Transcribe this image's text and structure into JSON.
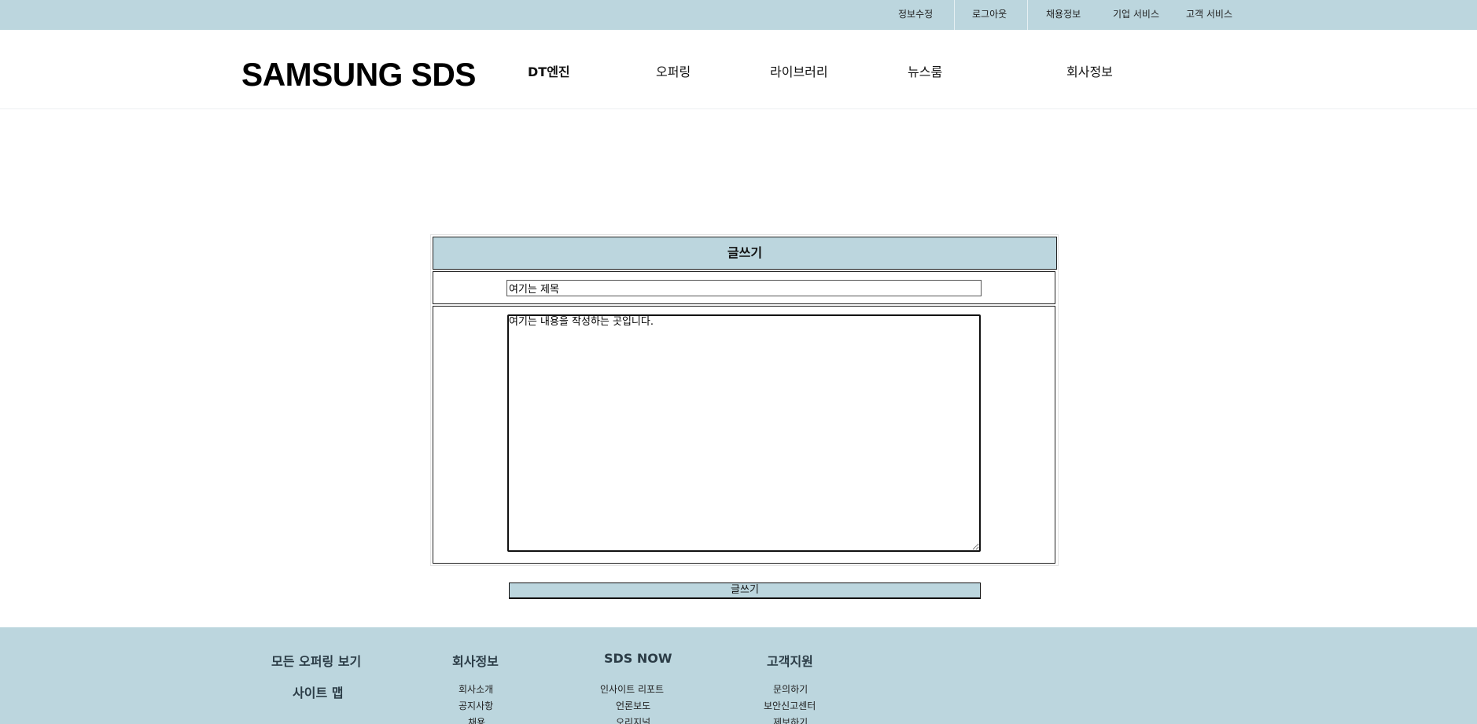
{
  "topbar": {
    "items": [
      {
        "label": "정보수정"
      },
      {
        "label": "로그아웃"
      },
      {
        "label": "채용정보"
      },
      {
        "label": "기업 서비스"
      },
      {
        "label": "고객 서비스"
      }
    ]
  },
  "header": {
    "logo": "SAMSUNG SDS",
    "nav": [
      {
        "label": "DT엔진"
      },
      {
        "label": "오퍼링"
      },
      {
        "label": "라이브러리"
      },
      {
        "label": "뉴스룸"
      },
      {
        "label": "회사정보"
      }
    ]
  },
  "form": {
    "heading": "글쓰기",
    "title_value": "여기는 제목",
    "content_value": "여기는 내용을 작성하는 곳입니다.",
    "submit_label": "글쓰기"
  },
  "footer": {
    "col1": {
      "heading1": "모든 오퍼링 보기",
      "heading2": "사이트 맵"
    },
    "col2": {
      "heading": "회사정보",
      "links": [
        "회사소개",
        "공지사항",
        "채용"
      ]
    },
    "col3": {
      "heading": "SDS NOW",
      "links": [
        "인사이트 리포트",
        "언론보도",
        "오리지널"
      ]
    },
    "col4": {
      "heading": "고객지원",
      "links": [
        "문의하기",
        "보안신고센터",
        "제보하기"
      ]
    }
  }
}
